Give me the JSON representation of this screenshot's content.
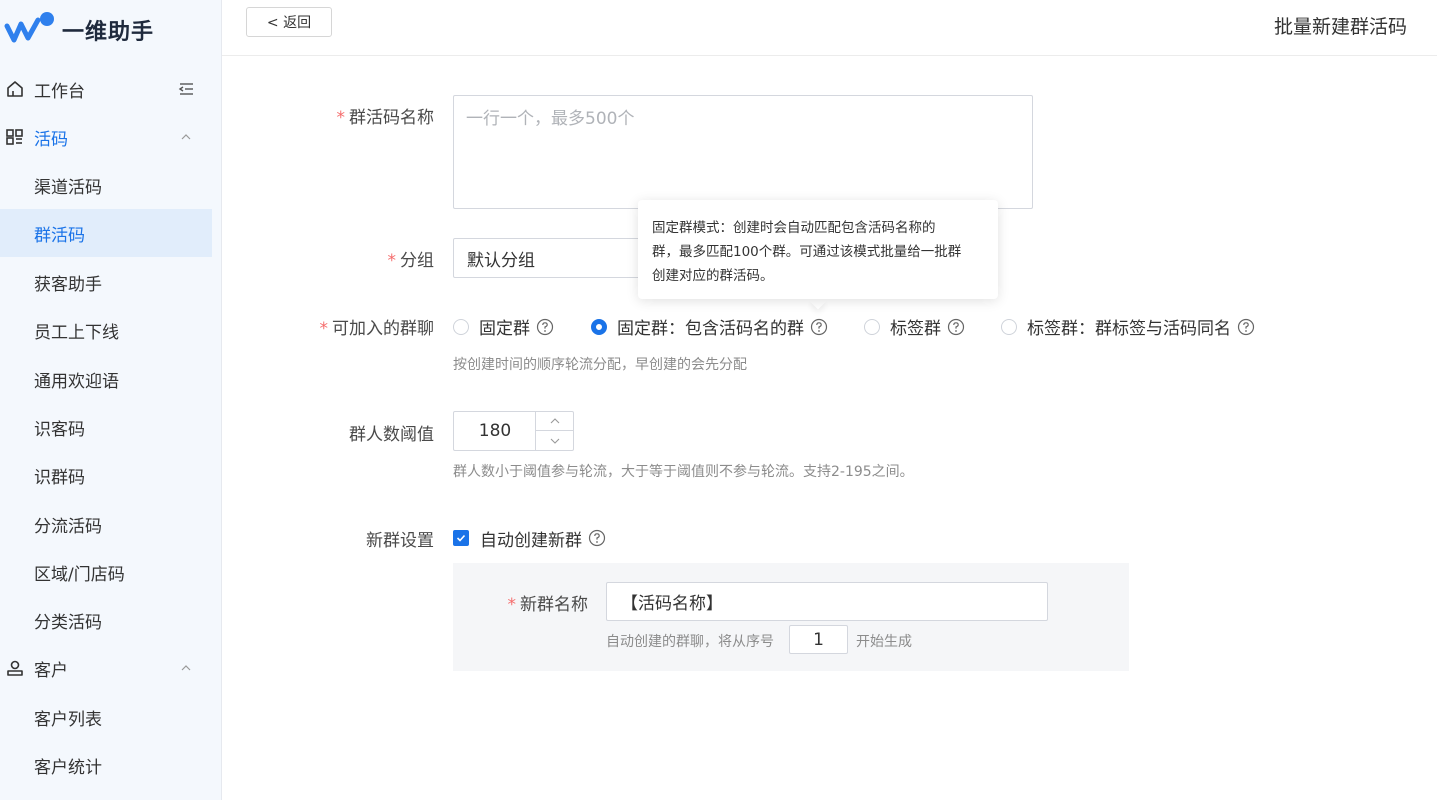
{
  "brand": {
    "name": "一维助手",
    "accent": "#1a73e8"
  },
  "sidebar": {
    "workbench": "工作台",
    "groups": [
      {
        "label": "活码",
        "items": [
          "渠道活码",
          "群活码",
          "获客助手",
          "员工上下线",
          "通用欢迎语",
          "识客码",
          "识群码",
          "分流活码",
          "区域/门店码",
          "分类活码"
        ],
        "active": "群活码"
      },
      {
        "label": "客户",
        "items": [
          "客户列表",
          "客户统计"
        ]
      }
    ]
  },
  "header": {
    "back_label": "< 返回",
    "title": "批量新建群活码"
  },
  "form": {
    "code_name": {
      "label": "群活码名称",
      "placeholder": "一行一个，最多500个"
    },
    "group": {
      "label": "分组",
      "value": "默认分组"
    },
    "chat_type": {
      "label": "可加入的群聊",
      "options": [
        "固定群",
        "固定群：包含活码名的群",
        "标签群",
        "标签群：群标签与活码同名"
      ],
      "selected": "固定群：包含活码名的群",
      "hint": "按创建时间的顺序轮流分配，早创建的会先分配"
    },
    "threshold": {
      "label": "群人数阈值",
      "value": "180",
      "hint": "群人数小于阈值参与轮流，大于等于阈值则不参与轮流。支持2-195之间。"
    },
    "new_group": {
      "label": "新群设置",
      "auto_create_label": "自动创建新群",
      "auto_create_checked": true,
      "name_label": "新群名称",
      "name_value": "【活码名称】",
      "seq_prefix": "自动创建的群聊，将从序号",
      "seq_value": "1",
      "seq_suffix": "开始生成"
    }
  },
  "tooltip": {
    "lines": [
      "固定群模式：创建时会自动匹配包含活码名称的",
      "群，最多匹配100个群。可通过该模式批量给一批群",
      "创建对应的群活码。"
    ]
  }
}
